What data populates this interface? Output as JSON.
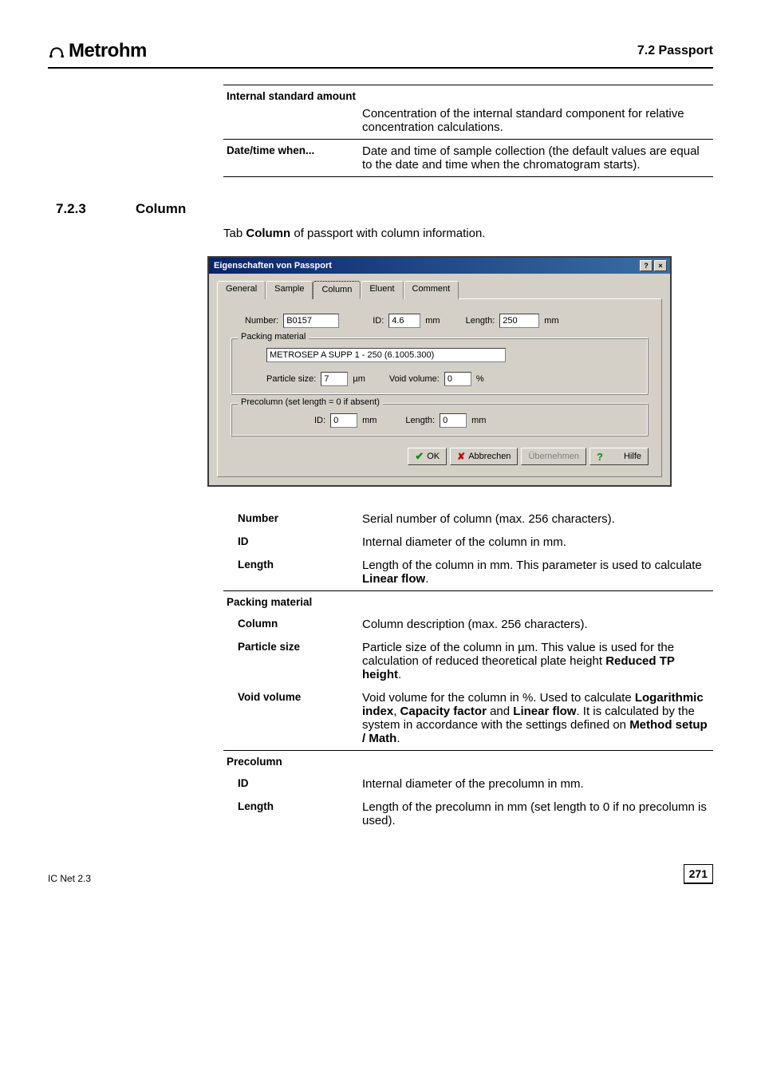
{
  "header": {
    "logo_text": "Metrohm",
    "section_ref": "7.2  Passport"
  },
  "pre_rows": [
    {
      "term": "Internal standard amount",
      "desc": "Concentration of the internal standard component for relative concentration calculations.",
      "spread": true,
      "indent": false
    },
    {
      "term": "Date/time when...",
      "desc": "Date and time of sample collection (the default values are equal to the date and time when the chromatogram starts).",
      "spread": false,
      "indent": false
    }
  ],
  "section": {
    "number": "7.2.3",
    "title": "Column"
  },
  "intro": {
    "prefix": "Tab ",
    "bold": "Column",
    "suffix": " of passport with column information."
  },
  "dialog": {
    "title": "Eigenschaften von Passport",
    "help_btn": "?",
    "close_btn": "×",
    "tabs": [
      "General",
      "Sample",
      "Column",
      "Eluent",
      "Comment"
    ],
    "active_tab_index": 2,
    "row1": {
      "number_label": "Number:",
      "number_val": "B0157",
      "id_label": "ID:",
      "id_val": "4.6",
      "id_unit": "mm",
      "length_label": "Length:",
      "length_val": "250",
      "length_unit": "mm"
    },
    "packing": {
      "legend": "Packing material",
      "text_val": "METROSEP A SUPP 1 - 250 (6.1005.300)",
      "psize_label": "Particle size:",
      "psize_val": "7",
      "psize_unit": "µm",
      "void_label": "Void volume:",
      "void_val": "0",
      "void_unit": "%"
    },
    "precol": {
      "legend": "Precolumn (set length = 0 if absent)",
      "id_label": "ID:",
      "id_val": "0",
      "id_unit": "mm",
      "length_label": "Length:",
      "length_val": "0",
      "length_unit": "mm"
    },
    "buttons": {
      "ok": "OK",
      "cancel": "Abbrechen",
      "apply": "Übernehmen",
      "help": "Hilfe"
    }
  },
  "post_rows": [
    {
      "term": "Number",
      "desc": "Serial number of column (max. 256 characters).",
      "indent": true
    },
    {
      "term": "ID",
      "desc": "Internal diameter of the column in mm.",
      "indent": true
    },
    {
      "term": "Length",
      "desc_html": "Length of the column in mm. This parameter is used to calculate <b>Linear flow</b>.",
      "indent": true,
      "brd_bottom": true
    },
    {
      "term": "Packing material",
      "desc": "",
      "indent": false
    },
    {
      "term": "Column",
      "desc": "Column description (max. 256 characters).",
      "indent": true
    },
    {
      "term": "Particle size",
      "desc_html": "Particle size of the column in µm. This value is used for the calculation of reduced theoretical plate height <b>Reduced TP height</b>.",
      "indent": true
    },
    {
      "term": "Void volume",
      "desc_html": "Void volume for the column in %. Used to calculate <b>Logarithmic index</b>, <b>Capacity factor</b> and <b>Linear flow</b>. It is calculated by the system in accordance with the settings defined on <b>Method setup / Math</b>.",
      "indent": true,
      "brd_bottom": true
    },
    {
      "term": "Precolumn",
      "desc": "",
      "indent": false
    },
    {
      "term": "ID",
      "desc": "Internal diameter of the precolumn in mm.",
      "indent": true
    },
    {
      "term": "Length",
      "desc": "Length of the precolumn in mm (set length to 0 if no precolumn is used).",
      "indent": true
    }
  ],
  "footer": {
    "left": "IC Net 2.3",
    "page": "271"
  },
  "chart_data": {
    "type": "table",
    "title": "Passport – Column tab field definitions",
    "rows": [
      [
        "Internal standard amount",
        "Concentration of the internal standard component for relative concentration calculations."
      ],
      [
        "Date/time when...",
        "Date and time of sample collection (the default values are equal to the date and time when the chromatogram starts)."
      ],
      [
        "Number",
        "Serial number of column (max. 256 characters)."
      ],
      [
        "ID",
        "Internal diameter of the column in mm."
      ],
      [
        "Length",
        "Length of the column in mm. This parameter is used to calculate Linear flow."
      ],
      [
        "Packing material / Column",
        "Column description (max. 256 characters)."
      ],
      [
        "Packing material / Particle size",
        "Particle size of the column in µm. This value is used for the calculation of reduced theoretical plate height Reduced TP height."
      ],
      [
        "Packing material / Void volume",
        "Void volume for the column in %. Used to calculate Logarithmic index, Capacity factor and Linear flow. It is calculated by the system in accordance with the settings defined on Method setup / Math."
      ],
      [
        "Precolumn / ID",
        "Internal diameter of the precolumn in mm."
      ],
      [
        "Precolumn / Length",
        "Length of the precolumn in mm (set length to 0 if no precolumn is used)."
      ]
    ],
    "dialog_values": {
      "Number": "B0157",
      "ID_mm": 4.6,
      "Length_mm": 250,
      "Packing_text": "METROSEP A SUPP 1 - 250 (6.1005.300)",
      "Particle_size_um": 7,
      "Void_volume_pct": 0,
      "Precolumn_ID_mm": 0,
      "Precolumn_Length_mm": 0
    }
  }
}
